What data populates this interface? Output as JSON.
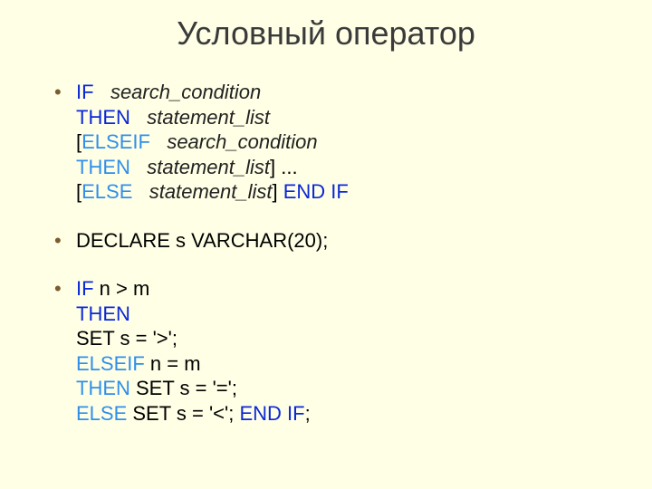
{
  "title": "Условный оператор",
  "bul1": {
    "l1a": "IF",
    "l1b": "search_condition",
    "l2a": "THEN",
    "l2b": "statement_list",
    "l3a": "[",
    "l3b": "ELSEIF",
    "l3c": "search_condition",
    "l4a": "THEN",
    "l4b": "statement_list",
    "l4c": "] ...",
    "l5a": "[",
    "l5b": "ELSE",
    "l5c": "statement_list",
    "l5d": "] ",
    "l5e": "END IF"
  },
  "bul2": "DECLARE s VARCHAR(20);",
  "bul3": {
    "l1a": "IF",
    "l1b": " n > m",
    "l2a": "THEN",
    "l3a": "SET s = '>';",
    "l4a": "ELSEIF",
    "l4b": " n = m",
    "l5a": "THEN",
    "l5b": " SET s = '=';",
    "l6a": "ELSE",
    "l6b": " SET s = '<'; ",
    "l6c": "END IF",
    "l6d": ";"
  }
}
